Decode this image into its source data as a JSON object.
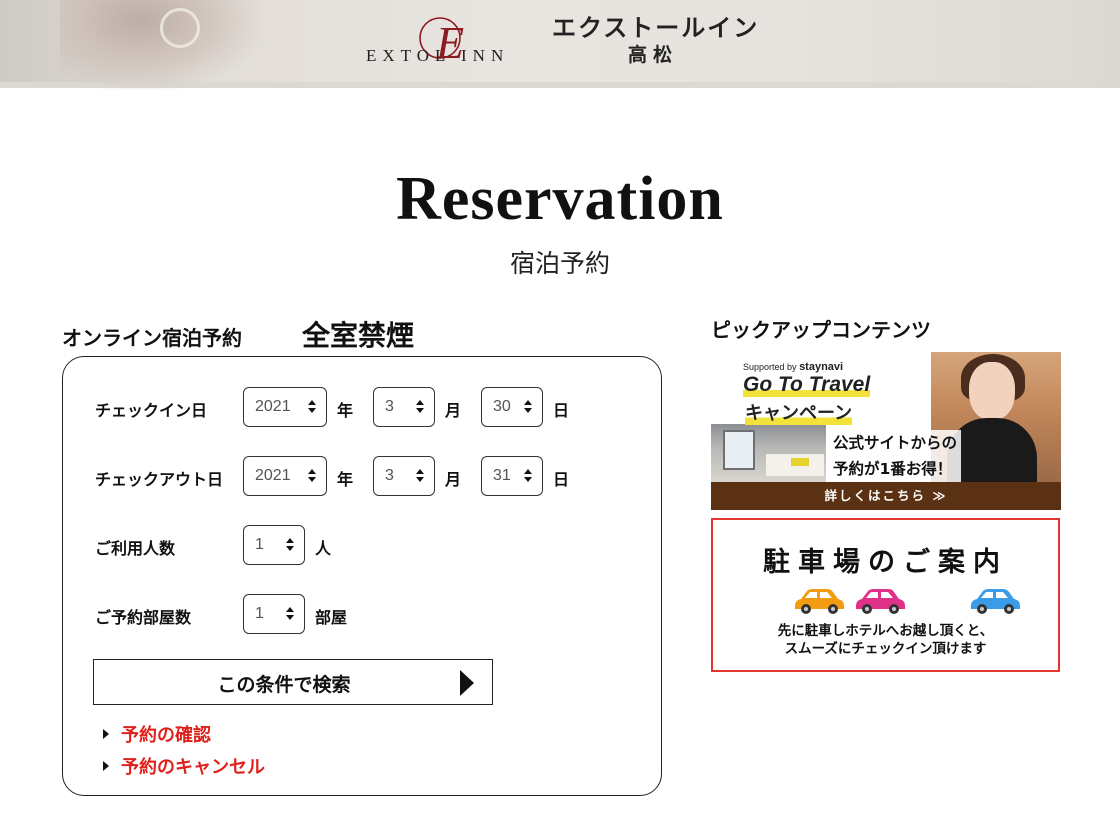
{
  "header": {
    "logo_initial": "E",
    "logo_latin": "EXTOL INN",
    "logo_jp": "エクストールイン",
    "logo_jp_sub": "高松"
  },
  "page": {
    "title": "Reservation",
    "subtitle": "宿泊予約"
  },
  "booking": {
    "label": "オンライン宿泊予約",
    "nosmoking": "全室禁煙",
    "checkin": {
      "label": "チェックイン日",
      "year": "2021",
      "month": "3",
      "day": "30"
    },
    "checkout": {
      "label": "チェックアウト日",
      "year": "2021",
      "month": "3",
      "day": "31"
    },
    "units": {
      "year": "年",
      "month": "月",
      "day": "日",
      "people": "人",
      "rooms": "部屋"
    },
    "guests": {
      "label": "ご利用人数",
      "value": "1"
    },
    "rooms": {
      "label": "ご予約部屋数",
      "value": "1"
    },
    "search_label": "この条件で検索",
    "links": {
      "confirm": "予約の確認",
      "cancel": "予約のキャンセル"
    },
    "link_color": "#e0201a"
  },
  "pickup": {
    "title": "ピックアップコンテンツ",
    "banner": {
      "supported": "Supported by",
      "brand": "staynavi",
      "goto": "Go To Travel",
      "campaign": "キャンペーン",
      "catch_line1": "公式サイトからの",
      "catch_line2": "予約が1番お得！",
      "details": "詳しくはこちら ≫",
      "bar_color": "#5a3213",
      "highlight_color": "#f3e23a"
    },
    "parking": {
      "title": "駐車場のご案内",
      "note_line1": "先に駐車しホテルへお越し頂くと、",
      "note_line2": "スムーズにチェックイン頂けます",
      "border_color": "#e4342f",
      "car_colors": [
        "#f39c12",
        "#e0318a",
        "#3a9be8"
      ]
    }
  }
}
